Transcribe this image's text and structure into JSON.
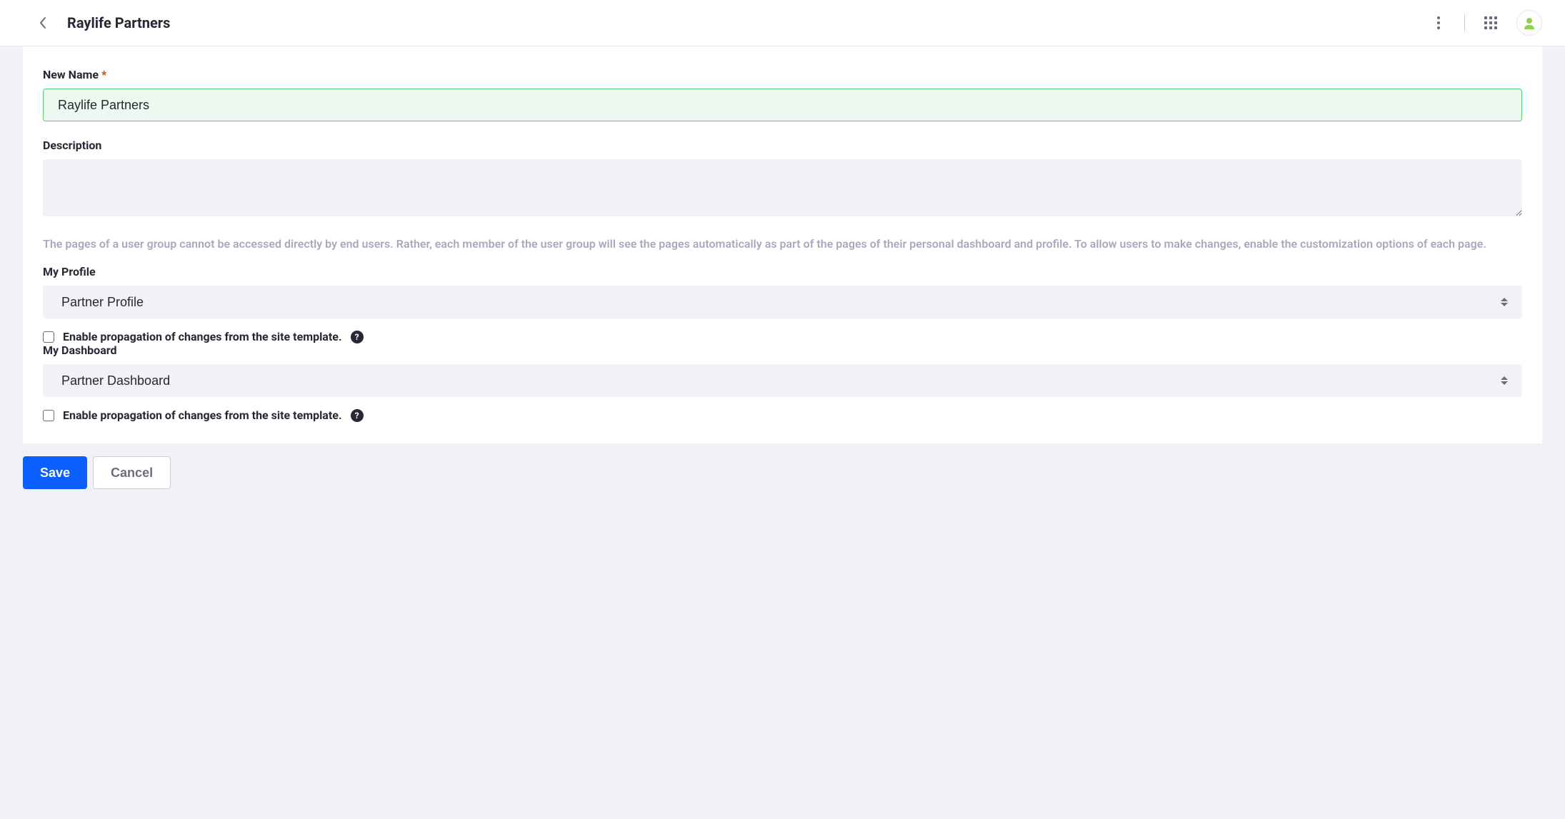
{
  "header": {
    "title": "Raylife Partners"
  },
  "form": {
    "name_label": "New Name",
    "name_value": "Raylife Partners",
    "description_label": "Description",
    "description_value": "",
    "help_text": "The pages of a user group cannot be accessed directly by end users. Rather, each member of the user group will see the pages automatically as part of the pages of their personal dashboard and profile. To allow users to make changes, enable the customization options of each page.",
    "profile_label": "My Profile",
    "profile_value": "Partner Profile",
    "profile_checkbox_label": "Enable propagation of changes from the site template.",
    "dashboard_label": "My Dashboard",
    "dashboard_value": "Partner Dashboard",
    "dashboard_checkbox_label": "Enable propagation of changes from the site template."
  },
  "buttons": {
    "save": "Save",
    "cancel": "Cancel"
  }
}
